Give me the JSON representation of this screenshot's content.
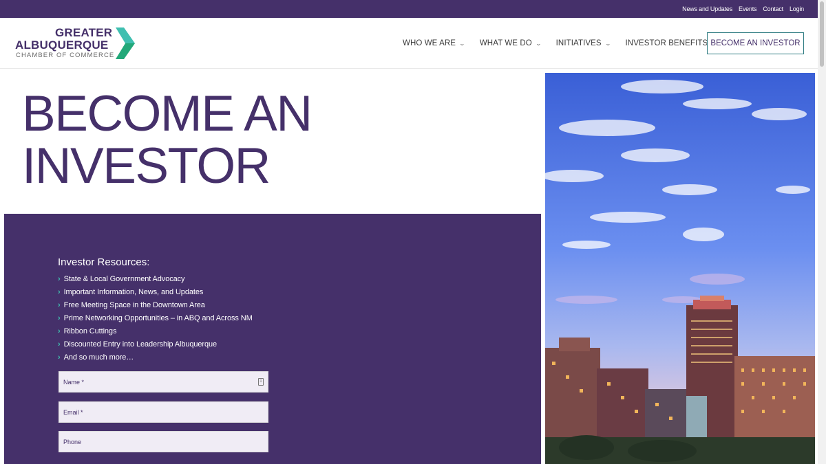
{
  "topbar": {
    "links": [
      "News and Updates",
      "Events",
      "Contact",
      "Login"
    ]
  },
  "logo": {
    "line1": "GREATER",
    "line2": "ALBUQUERQUE",
    "line3": "CHAMBER OF COMMERCE",
    "colors": {
      "primary": "#45306a",
      "accent_teal": "#3fbfb0",
      "accent_green": "#22a879"
    }
  },
  "nav": {
    "items": [
      {
        "label": "WHO WE ARE",
        "icon": "chevron-down-icon"
      },
      {
        "label": "WHAT WE DO",
        "icon": "chevron-down-icon"
      },
      {
        "label": "INITIATIVES",
        "icon": "chevron-down-icon"
      },
      {
        "label": "INVESTOR BENEFITS",
        "icon": "chevron-down-icon"
      }
    ],
    "cta_label": "BECOME AN INVESTOR"
  },
  "hero": {
    "title_line1": "BECOME AN",
    "title_line2": "INVESTOR"
  },
  "resources": {
    "title": "Investor Resources:",
    "items": [
      "State & Local Government Advocacy",
      "Important Information, News, and Updates",
      "Free Meeting Space in the Downtown Area",
      "Prime Networking Opportunities – in ABQ and Across NM",
      "Ribbon Cuttings",
      "Discounted Entry into Leadership Albuquerque",
      "And so much more…"
    ]
  },
  "form": {
    "name_placeholder": "Name *",
    "email_placeholder": "Email *",
    "phone_placeholder": "Phone"
  },
  "colors": {
    "brand_purple": "#45306a",
    "button_border": "#2f7c82",
    "field_bg": "#f0ecf5"
  }
}
